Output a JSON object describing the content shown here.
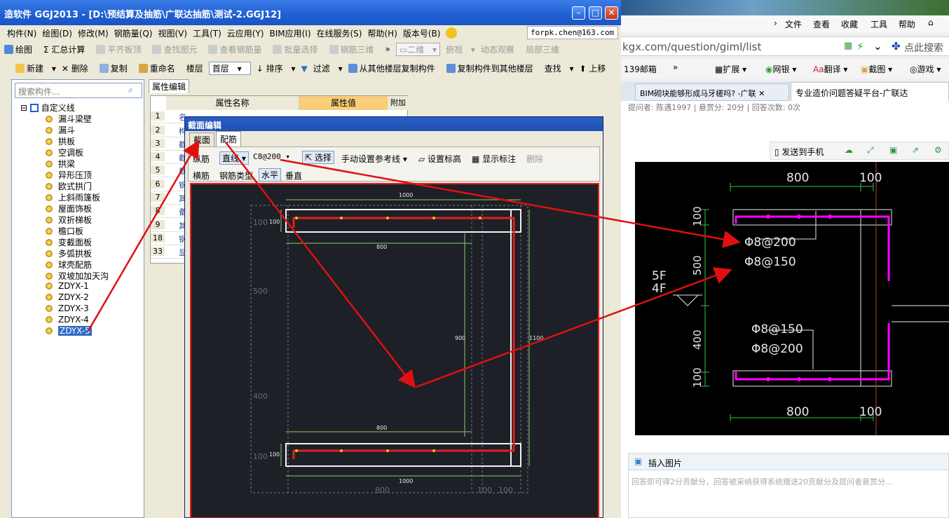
{
  "app": {
    "title": "造软件 GGJ2013 - [D:\\预结算及抽筋\\广联达抽筋\\测试-2.GGJ12]",
    "menu": [
      "构件(N)",
      "绘图(D)",
      "修改(M)",
      "钢筋量(Q)",
      "视图(V)",
      "工具(T)",
      "云应用(Y)",
      "BIM应用(I)",
      "在线服务(S)",
      "帮助(H)",
      "版本号(B)"
    ],
    "user": "forpk.chen@163.com",
    "toolbar1": {
      "draw": "绘图",
      "sum": "汇总计算",
      "flat": "平齐板顶",
      "find": "查找图元",
      "view_rebar": "查看钢筋量",
      "batch": "批量选择",
      "rebar3d": "钢筋三维",
      "view2d": "二维",
      "top_view": "俯视",
      "dynamic": "动态观察",
      "local3d": "局部三维"
    },
    "toolbar2": {
      "new": "新建",
      "delete": "删除",
      "copy": "复制",
      "rename": "重命名",
      "floor_label": "楼层",
      "floor_value": "首层",
      "sort": "排序",
      "filter": "过滤",
      "copy_from": "从其他楼层复制构件",
      "copy_to": "复制构件到其他楼层",
      "search": "查找",
      "up": "上移"
    },
    "tree": {
      "search_placeholder": "搜索构件...",
      "root": "自定义线",
      "items": [
        "漏斗梁壁",
        "漏斗",
        "拱板",
        "空调板",
        "拱梁",
        "异形压顶",
        "欧式拱门",
        "上斜雨篷板",
        "屋面饰板",
        "双折梯板",
        "檐口板",
        "变截面板",
        "多弧拱板",
        "球壳配筋",
        "双坡加加天沟",
        "ZDYX-1",
        "ZDYX-2",
        "ZDYX-3",
        "ZDYX-4",
        "ZDYX-5"
      ],
      "selected": "ZDYX-5"
    },
    "prop": {
      "tab": "属性编辑",
      "col_name": "属性名称",
      "col_value": "属性值",
      "col_extra": "附加",
      "rows": [
        "1",
        "2",
        "3",
        "4",
        "5",
        "6",
        "7",
        "8",
        "9",
        "18",
        "33"
      ],
      "name_frag": [
        "名",
        "构",
        "截",
        "截",
        "截",
        "钢",
        "其",
        "备",
        "其",
        "钢",
        "显"
      ]
    },
    "section_editor": {
      "title": "截面编辑",
      "tab1": "截面",
      "tab2": "配筋",
      "long_rebar": "纵筋",
      "straight": "直线",
      "spec": "C8@200",
      "select": "选择",
      "manual_ref": "手动设置参考线",
      "set_elev": "设置标高",
      "show_dim": "显示标注",
      "delete": "删除",
      "trans_rebar": "横筋",
      "rebar_type": "钢筋类型",
      "horizontal": "水平",
      "vertical": "垂直",
      "dims": {
        "top_1000": "1000",
        "d100a": "100",
        "top_800": "800",
        "d900": "900",
        "d1100": "1100",
        "bot_800": "800",
        "d100b": "100",
        "bot_1000": "1000",
        "b800": "800",
        "b100a": "100",
        "b100b": "100",
        "l100a": "100",
        "l500": "500",
        "l400": "400",
        "l100b": "100"
      }
    }
  },
  "browser": {
    "menu": [
      "文件",
      "查看",
      "收藏",
      "工具",
      "帮助"
    ],
    "url": "kgx.com/question/giml/list",
    "search_hint": "点此搜索",
    "bookmarks": [
      "139邮箱",
      "扩展",
      "网银",
      "翻译",
      "截图",
      "游戏"
    ],
    "tabs": [
      "BIM砌块能够形成马牙槎吗? -广联",
      "专业造价问题答疑平台-广联达"
    ],
    "meta": "提问者: 陈遇1997  |  悬赏分: 20分  |  回答次数: 0次",
    "send_phone": "发送到手机",
    "insert_image": "插入图片",
    "answer_placeholder": "回答即可得2分贡献分，回答被采纳获得系统赠送20贡献分及提问者悬赏分...",
    "cad": {
      "t800": "800",
      "t100": "100",
      "b800": "800",
      "b100": "100",
      "v100a": "100",
      "v500": "500",
      "v400": "400",
      "v100b": "100",
      "r1": "Φ8@200",
      "r2": "Φ8@150",
      "r3": "Φ8@150",
      "r4": "Φ8@200",
      "floor5": "5F",
      "floor4": "4F"
    }
  },
  "colors": {
    "accent": "#1f5fd1",
    "rebar": "#e02020",
    "magenta": "#ff00ff",
    "arrow": "#e01010"
  }
}
